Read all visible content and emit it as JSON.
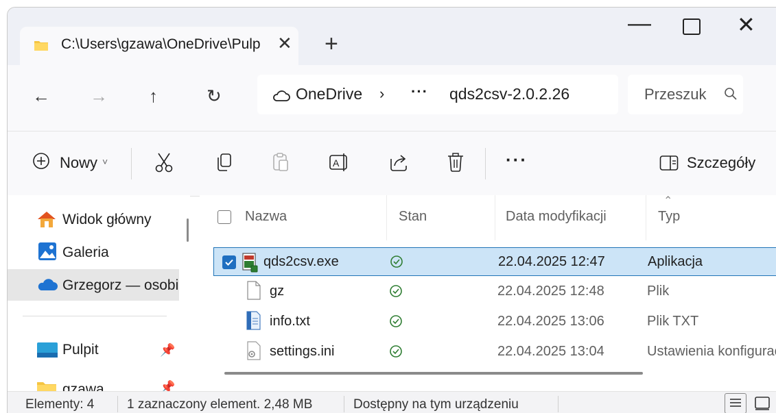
{
  "window": {
    "tab_title": "C:\\Users\\gzawa\\OneDrive\\Pulpit",
    "tab_close": "✕",
    "new_tab": "+",
    "minimize": "—",
    "close": "✕"
  },
  "nav": {
    "back": "←",
    "forward": "→",
    "up": "↑",
    "refresh": "↻",
    "breadcrumb": [
      "OneDrive",
      "›",
      "···",
      "qds2csv-2.0.2.26"
    ],
    "search_placeholder": "Przeszuk"
  },
  "toolbar": {
    "new_label": "Nowy",
    "new_caret": "˅",
    "more": "···",
    "details_label": "Szczegóły"
  },
  "sidebar": {
    "items": [
      {
        "label": "Widok główny",
        "icon": "home-icon"
      },
      {
        "label": "Galeria",
        "icon": "gallery-icon"
      },
      {
        "label": "Grzegorz — osobiste",
        "icon": "onedrive-icon",
        "selected": true
      },
      {
        "label": "Pulpit",
        "icon": "desktop-icon",
        "pinned": true
      },
      {
        "label": "gzawa",
        "icon": "folder-icon",
        "pinned": true
      }
    ]
  },
  "table": {
    "columns": [
      "Nazwa",
      "Stan",
      "Data modyfikacji",
      "Typ"
    ],
    "rows": [
      {
        "name": "qds2csv.exe",
        "date": "22.04.2025 12:47",
        "type": "Aplikacja",
        "icon": "exe-icon",
        "selected": true
      },
      {
        "name": "gz",
        "date": "22.04.2025 12:48",
        "type": "Plik",
        "icon": "blank-file-icon"
      },
      {
        "name": "info.txt",
        "date": "22.04.2025 13:06",
        "type": "Plik TXT",
        "icon": "txt-file-icon"
      },
      {
        "name": "settings.ini",
        "date": "22.04.2025 13:04",
        "type": "Ustawienia konfiguracji",
        "icon": "ini-file-icon"
      }
    ]
  },
  "status": {
    "count": "Elementy: 4",
    "selection": "1 zaznaczony element. 2,48 MB",
    "availability": "Dostępny na tym urządzeniu"
  },
  "colors": {
    "accent": "#1f6fc0",
    "selection_bg": "#cce4f7",
    "sync_ok": "#2e7d32"
  }
}
